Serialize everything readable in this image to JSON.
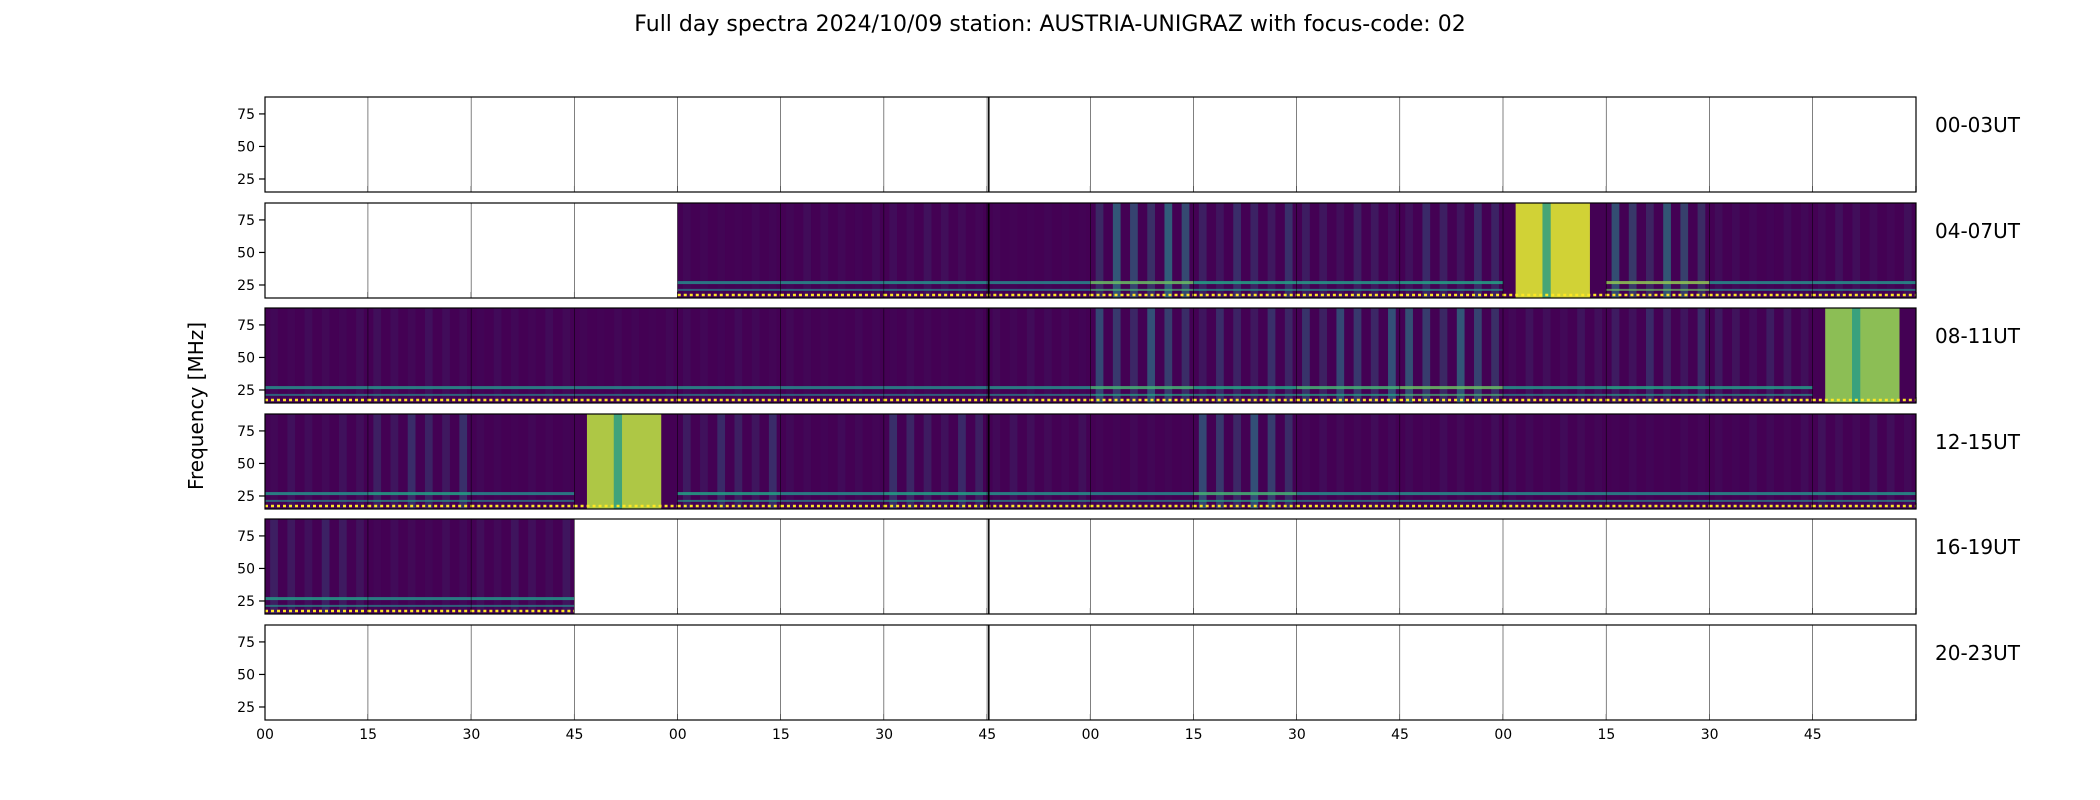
{
  "chart_data": {
    "type": "heatmap",
    "title": "Full day spectra 2024/10/09 station: AUSTRIA-UNIGRAZ with focus-code: 02",
    "ylabel": "Frequency [MHz]",
    "ytick_labels": [
      "75",
      "50",
      "25"
    ],
    "yticks": [
      75,
      50,
      25
    ],
    "ylim": [
      15,
      88
    ],
    "xtick_labels": [
      "00",
      "15",
      "30",
      "45",
      "00",
      "15",
      "30",
      "45",
      "00",
      "15",
      "30",
      "45",
      "00",
      "15",
      "30",
      "45"
    ],
    "colormap": "viridis",
    "colors": {
      "low": "#440154",
      "mid": "#2a788e",
      "high": "#22a884",
      "peak": "#fde725",
      "empty": "#ffffff"
    },
    "rows": [
      {
        "label": "00-03UT",
        "cells": [
          0,
          0,
          0,
          0,
          0,
          0,
          0,
          0,
          0,
          0,
          0,
          0,
          0,
          0,
          0,
          0
        ]
      },
      {
        "label": "04-07UT",
        "cells": [
          0,
          0,
          0,
          0,
          0.12,
          0.15,
          0.18,
          0.1,
          0.45,
          0.3,
          0.25,
          0.3,
          0.95,
          0.5,
          0.15,
          0.18
        ]
      },
      {
        "label": "08-11UT",
        "cells": [
          0.15,
          0.18,
          0.15,
          0.12,
          0.15,
          0.12,
          0.12,
          0.15,
          0.4,
          0.3,
          0.4,
          0.45,
          0.2,
          0.3,
          0.25,
          0.85
        ]
      },
      {
        "label": "12-15UT",
        "cells": [
          0.18,
          0.3,
          0.12,
          0.9,
          0.3,
          0.15,
          0.3,
          0.18,
          0.12,
          0.4,
          0.15,
          0.15,
          0.15,
          0.12,
          0.15,
          0.2
        ]
      },
      {
        "label": "16-19UT",
        "cells": [
          0.25,
          0.15,
          0.2,
          0,
          0,
          0,
          0,
          0,
          0,
          0,
          0,
          0,
          0,
          0,
          0,
          0
        ]
      },
      {
        "label": "20-23UT",
        "cells": [
          0,
          0,
          0,
          0,
          0,
          0,
          0,
          0,
          0,
          0,
          0,
          0,
          0,
          0,
          0,
          0
        ]
      }
    ]
  }
}
